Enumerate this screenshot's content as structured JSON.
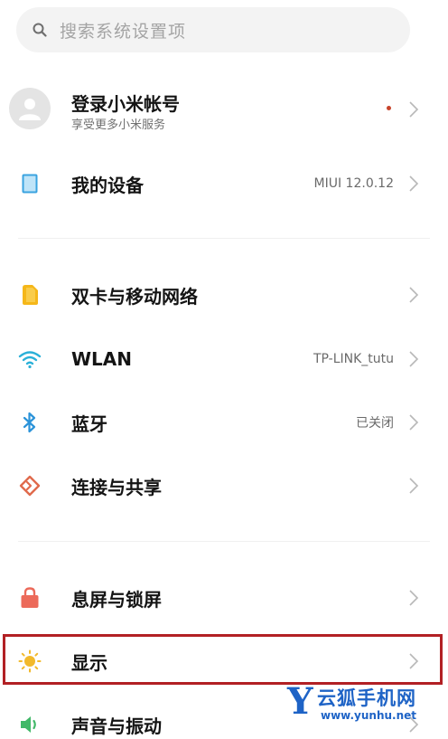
{
  "search": {
    "placeholder": "搜索系统设置项"
  },
  "account": {
    "title": "登录小米帐号",
    "subtitle": "享受更多小米服务"
  },
  "device": {
    "title": "我的设备",
    "value": "MIUI 12.0.12"
  },
  "network": [
    {
      "title": "双卡与移动网络",
      "value": "",
      "icon": "sim-card-icon"
    },
    {
      "title": "WLAN",
      "value": "TP-LINK_tutu",
      "icon": "wifi-icon"
    },
    {
      "title": "蓝牙",
      "value": "已关闭",
      "icon": "bluetooth-icon"
    },
    {
      "title": "连接与共享",
      "value": "",
      "icon": "connection-sharing-icon"
    }
  ],
  "system": [
    {
      "title": "息屏与锁屏",
      "icon": "lock-icon"
    },
    {
      "title": "显示",
      "icon": "sun-icon"
    },
    {
      "title": "声音与振动",
      "icon": "speaker-icon"
    }
  ],
  "watermark": {
    "name": "云狐手机网",
    "url": "www.yunhu.net"
  },
  "colors": {
    "highlight": "#b22024",
    "sim": "#f5b719",
    "wifi": "#2ab0d8",
    "bluetooth": "#2b93d9",
    "share": "#e06a4c",
    "lock": "#ec6a5a",
    "sun": "#f2b92b",
    "sound": "#41b868"
  }
}
